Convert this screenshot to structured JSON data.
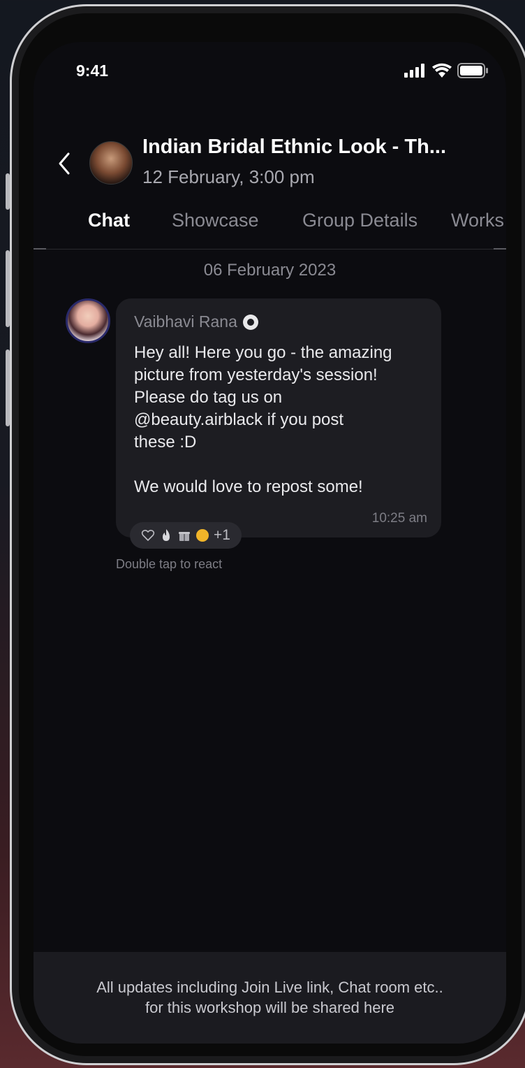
{
  "status_bar": {
    "time": "9:41",
    "icons": [
      "cellular-signal-icon",
      "wifi-icon",
      "battery-icon"
    ]
  },
  "header": {
    "title": "Indian Bridal Ethnic Look - Th...",
    "subtitle": "12 February, 3:00 pm",
    "back_icon": "chevron-left-icon"
  },
  "tabs": [
    {
      "label": "Chat",
      "active": true
    },
    {
      "label": "Showcase",
      "active": false
    },
    {
      "label": "Group Details",
      "active": false
    },
    {
      "label": "Works",
      "active": false
    }
  ],
  "chat": {
    "date_label": "06 February 2023",
    "message": {
      "sender": "Vaibhavi Rana",
      "text": "Hey all! Here you go - the amazing\npicture from yesterday's session!\nPlease do tag us on\n@beauty.airblack if you post\nthese :D\n\nWe would love to repost some!",
      "time": "10:25 am",
      "reaction_count": "+1",
      "hint": "Double tap to react"
    }
  },
  "footer": {
    "line1": "All updates including Join Live link, Chat room etc..",
    "line2": "for this workshop will be shared here"
  },
  "colors": {
    "background": "#0c0c10",
    "bubble": "#1d1d22",
    "text_primary": "#ffffff",
    "text_secondary": "#a9a9b0"
  }
}
